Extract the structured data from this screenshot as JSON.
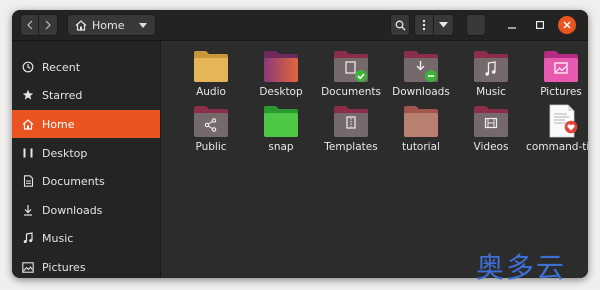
{
  "header": {
    "nav_back_icon": "chevron-left-icon",
    "nav_forward_icon": "chevron-right-icon",
    "path_icon": "home-icon",
    "path_label": "Home",
    "search_icon": "search-icon",
    "menu_icon": "kebab-menu-icon",
    "view_icon": "chevron-down-icon",
    "minimize_icon": "minimize-icon",
    "maximize_icon": "maximize-icon",
    "close_icon": "close-icon"
  },
  "sidebar": {
    "items": [
      {
        "label": "Recent",
        "icon": "clock-icon",
        "active": false
      },
      {
        "label": "Starred",
        "icon": "star-icon",
        "active": false
      },
      {
        "label": "Home",
        "icon": "home-icon",
        "active": true
      },
      {
        "label": "Desktop",
        "icon": "desktop-icon",
        "active": false
      },
      {
        "label": "Documents",
        "icon": "document-icon",
        "active": false
      },
      {
        "label": "Downloads",
        "icon": "download-icon",
        "active": false
      },
      {
        "label": "Music",
        "icon": "music-icon",
        "active": false
      },
      {
        "label": "Pictures",
        "icon": "picture-icon",
        "active": false
      }
    ]
  },
  "files": [
    {
      "label": "Audio",
      "icon": "folder-icon"
    },
    {
      "label": "Desktop",
      "icon": "desktop-folder-icon"
    },
    {
      "label": "Documents",
      "icon": "documents-folder-icon"
    },
    {
      "label": "Downloads",
      "icon": "downloads-folder-icon"
    },
    {
      "label": "Music",
      "icon": "music-folder-icon"
    },
    {
      "label": "Pictures",
      "icon": "pictures-folder-icon"
    },
    {
      "label": "Public",
      "icon": "public-folder-icon"
    },
    {
      "label": "snap",
      "icon": "folder-icon"
    },
    {
      "label": "Templates",
      "icon": "templates-folder-icon"
    },
    {
      "label": "tutorial",
      "icon": "folder-icon"
    },
    {
      "label": "Videos",
      "icon": "videos-folder-icon"
    },
    {
      "label": "command-tip",
      "icon": "text-file-icon"
    }
  ],
  "colors": {
    "accent": "#e95420",
    "window_bg": "#2c2c2c",
    "sidebar_bg": "#242424",
    "header_bg": "#232323"
  },
  "watermark": "奥多云"
}
